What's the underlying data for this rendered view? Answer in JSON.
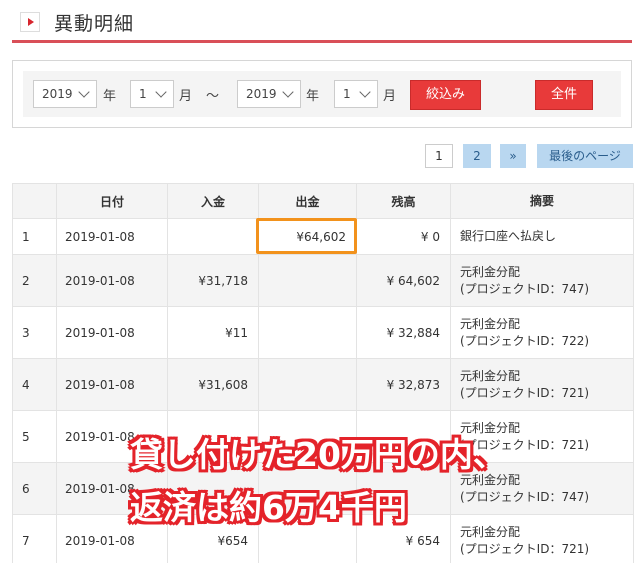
{
  "header": {
    "title": "異動明細"
  },
  "filter": {
    "from_year": "2019",
    "from_month": "1",
    "to_year": "2019",
    "to_month": "1",
    "year_label": "年",
    "month_label": "月",
    "range_sep": "～",
    "filter_button": "絞込み",
    "all_button": "全件"
  },
  "pagination": {
    "current": "1",
    "page2": "2",
    "next": "»",
    "last": "最後のページ"
  },
  "table": {
    "headers": {
      "no": "",
      "date": "日付",
      "in": "入金",
      "out": "出金",
      "balance": "残高",
      "desc": "摘要"
    },
    "rows": [
      {
        "no": "1",
        "date": "2019-01-08",
        "in": "",
        "out": "¥64,602",
        "balance": "¥ 0",
        "desc1": "銀行口座へ払戻し",
        "desc2": ""
      },
      {
        "no": "2",
        "date": "2019-01-08",
        "in": "¥31,718",
        "out": "",
        "balance": "¥ 64,602",
        "desc1": "元利金分配",
        "desc2": "(プロジェクトID：747)"
      },
      {
        "no": "3",
        "date": "2019-01-08",
        "in": "¥11",
        "out": "",
        "balance": "¥ 32,884",
        "desc1": "元利金分配",
        "desc2": "(プロジェクトID：722)"
      },
      {
        "no": "4",
        "date": "2019-01-08",
        "in": "¥31,608",
        "out": "",
        "balance": "¥ 32,873",
        "desc1": "元利金分配",
        "desc2": "(プロジェクトID：721)"
      },
      {
        "no": "5",
        "date": "2019-01-08",
        "in": "",
        "out": "",
        "balance": "",
        "desc1": "元利金分配",
        "desc2": "(プロジェクトID：721)"
      },
      {
        "no": "6",
        "date": "2019-01-08",
        "in": "",
        "out": "",
        "balance": "",
        "desc1": "元利金分配",
        "desc2": "(プロジェクトID：747)"
      },
      {
        "no": "7",
        "date": "2019-01-08",
        "in": "¥654",
        "out": "",
        "balance": "¥ 654",
        "desc1": "元利金分配",
        "desc2": "(プロジェクトID：721)"
      }
    ]
  },
  "overlay": {
    "line1": "貸し付けた20万円の内、",
    "line2": "返済は約6万4千円"
  },
  "colors": {
    "accent": "#e83a3a",
    "header_line": "#d94f58",
    "highlight": "#f2921c",
    "caption_outline": "#e4232a",
    "pager_bg": "#b9d7f0"
  }
}
